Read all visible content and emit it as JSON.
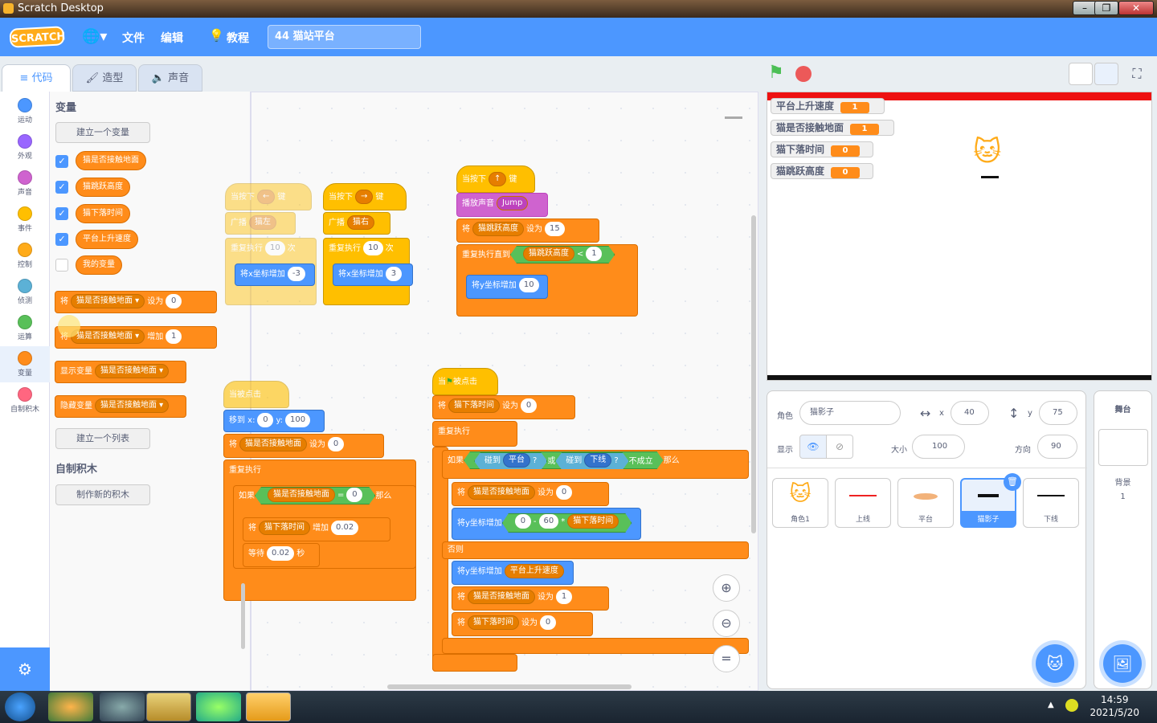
{
  "window": {
    "title": "Scratch Desktop",
    "min": "–",
    "max": "❐",
    "close": "✕"
  },
  "menubar": {
    "logo": "SCRATCH",
    "file": "文件",
    "edit": "编辑",
    "tutorials": "教程",
    "project_title": "44 猫站平台"
  },
  "tabs": {
    "code": "代码",
    "costumes": "造型",
    "sounds": "声音"
  },
  "categories": [
    {
      "label": "运动",
      "color": "#4c97ff"
    },
    {
      "label": "外观",
      "color": "#9966ff"
    },
    {
      "label": "声音",
      "color": "#cf63cf"
    },
    {
      "label": "事件",
      "color": "#ffbf00"
    },
    {
      "label": "控制",
      "color": "#ffab19"
    },
    {
      "label": "侦测",
      "color": "#5cb1d6"
    },
    {
      "label": "运算",
      "color": "#59c059"
    },
    {
      "label": "变量",
      "color": "#ff8c1a"
    },
    {
      "label": "自制积木",
      "color": "#ff6680"
    }
  ],
  "palette": {
    "heading": "变量",
    "make_var": "建立一个变量",
    "vars": [
      "猫是否接触地面",
      "猫跳跃高度",
      "猫下落时间",
      "平台上升速度",
      "我的变量"
    ],
    "set_label": "将",
    "set_to": "设为",
    "set_val": "0",
    "change_label": "将",
    "change_by": "增加",
    "change_val": "1",
    "show_var": "显示变量",
    "hide_var": "隐藏变量",
    "make_list": "建立一个列表",
    "myblocks_heading": "自制积木",
    "make_block": "制作新的积木"
  },
  "scripts": {
    "left_key": "当按下",
    "left_arrow": "←",
    "key_suffix": "键",
    "broadcast": "广播",
    "cat_left": "猫左",
    "repeat": "重复执行",
    "times": "次",
    "change_x": "将x坐标增加",
    "repeat_n": "10",
    "neg3": "-3",
    "right_arrow": "→",
    "cat_right": "猫右",
    "pos3": "3",
    "up_arrow": "↑",
    "play_sound": "播放声音",
    "jump": "Jump",
    "set15": "15",
    "repeat_until": "重复执行直到",
    "lt": "<",
    "one": "1",
    "change_y": "将y坐标增加",
    "ten": "10",
    "flag_clicked": "当",
    "clicked_suffix": "被点击",
    "goto": "移到 x:",
    "gx": "0",
    "gy_label": "y:",
    "gy": "100",
    "if": "如果",
    "eq": "=",
    "then": "那么",
    "wait": "等待",
    "wait_val": "0.02",
    "seconds": "秒",
    "inc": "0.02",
    "touching": "碰到",
    "platform": "平台",
    "q": "?",
    "or": "或",
    "bottom_line": "下线",
    "not_hold": "不成立",
    "sixty": "60",
    "minus": "-",
    "times_op": "*",
    "else": "否则",
    "rise_speed": "平台上升速度",
    "zero": "0"
  },
  "stage": {
    "monitors": [
      {
        "name": "平台上升速度",
        "value": "1"
      },
      {
        "name": "猫是否接触地面",
        "value": "1"
      },
      {
        "name": "猫下落时间",
        "value": "0"
      },
      {
        "name": "猫跳跃高度",
        "value": "0"
      }
    ]
  },
  "sprite_info": {
    "sprite_label": "角色",
    "sprite_name": "猫影子",
    "x_label": "x",
    "x": "40",
    "y_label": "y",
    "y": "75",
    "show_label": "显示",
    "size_label": "大小",
    "size": "100",
    "dir_label": "方向",
    "dir": "90"
  },
  "sprites": [
    "角色1",
    "上线",
    "平台",
    "猫影子",
    "下线"
  ],
  "stage_panel": {
    "title": "舞台",
    "backdrops_label": "背景",
    "backdrops_count": "1"
  },
  "taskbar": {
    "time": "14:59",
    "date": "2021/5/20"
  }
}
